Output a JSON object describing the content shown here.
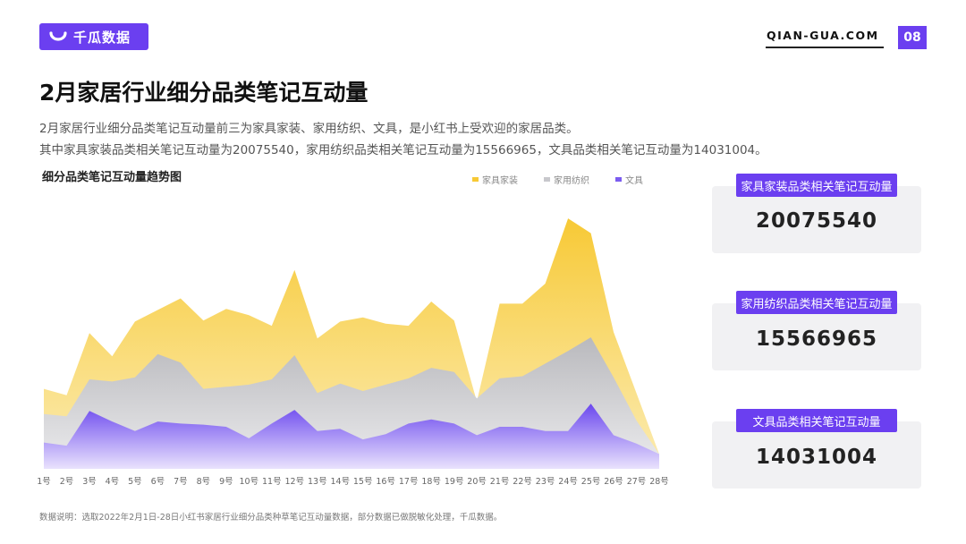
{
  "header": {
    "brand_name": "千瓜数据",
    "site": "QIAN-GUA.COM",
    "page_number": "08",
    "brand_color": "#6b3ff0"
  },
  "title": "2月家居行业细分品类笔记互动量",
  "description": {
    "line1": "2月家居行业细分品类笔记互动量前三为家具家装、家用纺织、文具，是小红书上受欢迎的家居品类。",
    "line2": "其中家具家装品类相关笔记互动量为20075540，家用纺织品类相关笔记互动量为15566965，文具品类相关笔记互动量为14031004。"
  },
  "stats": [
    {
      "label": "家具家装品类相关笔记互动量",
      "value": "20075540"
    },
    {
      "label": "家用纺织品类相关笔记互动量",
      "value": "15566965"
    },
    {
      "label": "文具品类相关笔记互动量",
      "value": "14031004"
    }
  ],
  "footnote": "数据说明：选取2022年2月1日-28日小红书家居行业细分品类种草笔记互动量数据，部分数据已做脱敏化处理，千瓜数据。",
  "chart_data": {
    "type": "area",
    "title": "细分品类笔记互动量趋势图",
    "legend_position": "top-right",
    "grid": false,
    "categories": [
      "1号",
      "2号",
      "3号",
      "4号",
      "5号",
      "6号",
      "7号",
      "8号",
      "9号",
      "10号",
      "11号",
      "12号",
      "13号",
      "14号",
      "15号",
      "16号",
      "17号",
      "18号",
      "19号",
      "20号",
      "21号",
      "22号",
      "23号",
      "24号",
      "25号",
      "26号",
      "27号",
      "28号"
    ],
    "ylim": [
      0,
      250
    ],
    "series": [
      {
        "name": "家具家装",
        "color": "#f7c935",
        "values": [
          76,
          70,
          129,
          107,
          140,
          151,
          162,
          141,
          152,
          146,
          136,
          189,
          124,
          140,
          144,
          138,
          136,
          159,
          141,
          64,
          157,
          157,
          176,
          238,
          224,
          130,
          72,
          14
        ]
      },
      {
        "name": "家用纺织",
        "color": "#c8c8cc",
        "values": [
          52,
          50,
          85,
          83,
          87,
          109,
          101,
          76,
          78,
          80,
          85,
          108,
          72,
          81,
          74,
          80,
          86,
          96,
          92,
          67,
          86,
          88,
          100,
          112,
          125,
          87,
          46,
          14
        ]
      },
      {
        "name": "文具",
        "color": "#7b5cf0",
        "values": [
          25,
          22,
          55,
          45,
          36,
          45,
          43,
          42,
          40,
          29,
          43,
          56,
          36,
          38,
          28,
          33,
          43,
          47,
          43,
          32,
          40,
          40,
          36,
          36,
          62,
          32,
          24,
          14
        ]
      }
    ]
  }
}
